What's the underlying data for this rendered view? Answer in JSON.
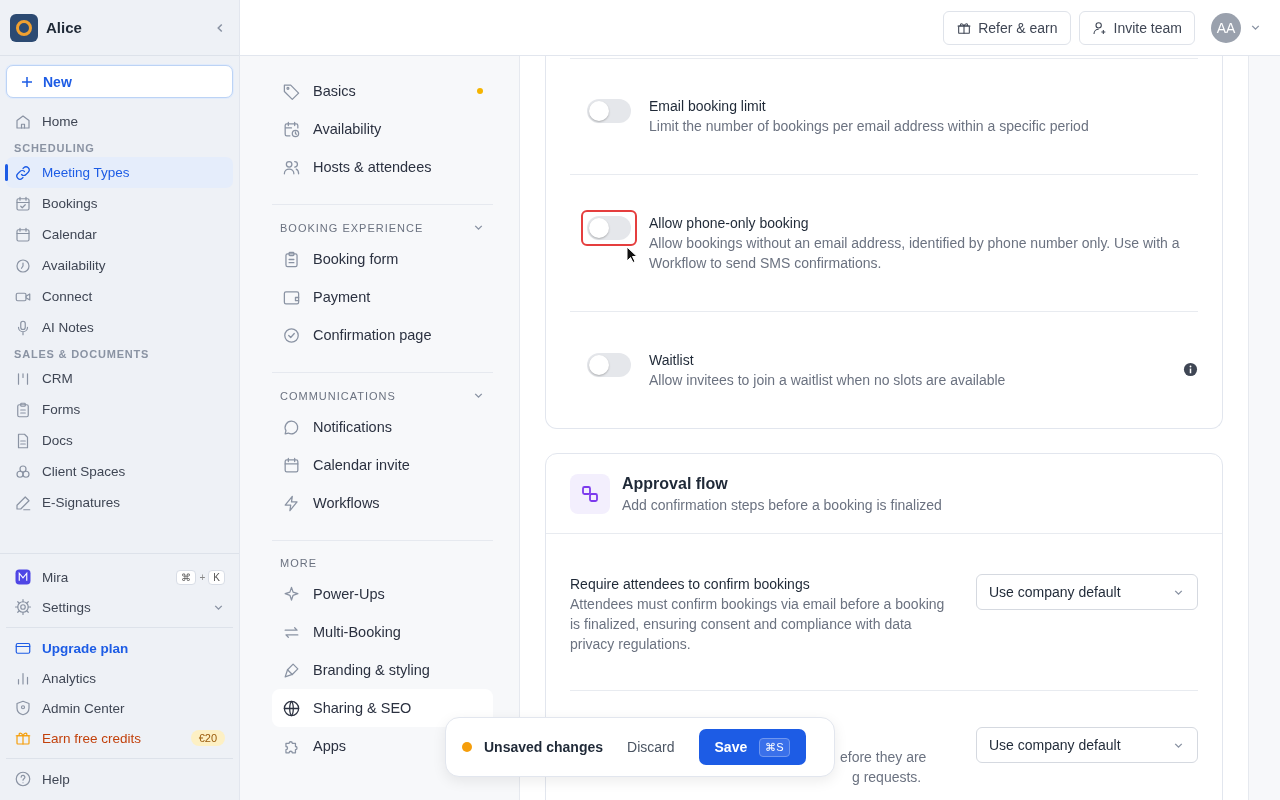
{
  "workspace": {
    "name": "Alice"
  },
  "sidebar": {
    "new_button": "New",
    "items": [
      {
        "label": "Home",
        "selected": false
      }
    ],
    "sections": [
      {
        "heading": "SCHEDULING",
        "items": [
          {
            "label": "Meeting Types",
            "selected": true
          },
          {
            "label": "Bookings",
            "selected": false
          },
          {
            "label": "Calendar",
            "selected": false
          },
          {
            "label": "Availability",
            "selected": false
          },
          {
            "label": "Connect",
            "selected": false
          },
          {
            "label": "AI Notes",
            "selected": false
          }
        ]
      },
      {
        "heading": "SALES & DOCUMENTS",
        "items": [
          {
            "label": "CRM",
            "selected": false
          },
          {
            "label": "Forms",
            "selected": false
          },
          {
            "label": "Docs",
            "selected": false
          },
          {
            "label": "Client Spaces",
            "selected": false
          },
          {
            "label": "E-Signatures",
            "selected": false
          }
        ]
      }
    ],
    "assistant": {
      "label": "Mira",
      "shortcut": [
        "⌘",
        "+",
        "K"
      ]
    },
    "settings": {
      "label": "Settings",
      "expanded": false
    },
    "bottom": [
      {
        "kind": "upgrade",
        "label": "Upgrade plan"
      },
      {
        "kind": "plain",
        "label": "Analytics"
      },
      {
        "kind": "plain",
        "label": "Admin Center"
      },
      {
        "kind": "promo",
        "label": "Earn free credits",
        "badge": "€20"
      }
    ],
    "help": "Help"
  },
  "top_bar": {
    "buttons": [
      "Refer & earn",
      "Invite team"
    ],
    "avatar": "AA"
  },
  "settings_nav": {
    "items": [
      {
        "label": "Basics",
        "selected": false,
        "modified": true
      },
      {
        "label": "Availability",
        "selected": false,
        "modified": false
      },
      {
        "label": "Hosts & attendees",
        "selected": false,
        "modified": false
      }
    ],
    "groups": [
      {
        "heading": "BOOKING EXPERIENCE",
        "expanded": true,
        "items": [
          {
            "label": "Booking form",
            "selected": false
          },
          {
            "label": "Payment",
            "selected": false
          },
          {
            "label": "Confirmation page",
            "selected": false
          }
        ]
      },
      {
        "heading": "COMMUNICATIONS",
        "expanded": true,
        "items": [
          {
            "label": "Notifications",
            "selected": false
          },
          {
            "label": "Calendar invite",
            "selected": false
          },
          {
            "label": "Workflows",
            "selected": false
          }
        ]
      },
      {
        "heading": "MORE",
        "items": [
          {
            "label": "Power-Ups",
            "selected": false
          },
          {
            "label": "Multi-Booking",
            "selected": false
          },
          {
            "label": "Branding & styling",
            "selected": false
          },
          {
            "label": "Sharing & SEO",
            "selected": true
          },
          {
            "label": "Apps",
            "selected": false
          }
        ]
      }
    ]
  },
  "toggles": [
    {
      "title": "Email booking limit",
      "description": "Limit the number of bookings per email address within a specific period",
      "on": false,
      "focused": false
    },
    {
      "title": "Allow phone-only booking",
      "description": "Allow bookings without an email address, identified by phone number only. Use with a Workflow to send SMS confirmations.",
      "on": false,
      "focused": true
    },
    {
      "title": "Waitlist",
      "description": "Allow invitees to join a waitlist when no slots are available",
      "on": false,
      "focused": false,
      "info": true
    }
  ],
  "approval_flow": {
    "title": "Approval flow",
    "subtitle": "Add confirmation steps before a booking is finalized",
    "rows": [
      {
        "title": "Require attendees to confirm bookings",
        "description": "Attendees must confirm bookings via email before a booking is finalized, ensuring consent and compliance with data privacy regulations.",
        "select": "Use company default"
      },
      {
        "description_lines": [
          "efore they are",
          "g requests."
        ],
        "select": "Use company default"
      }
    ]
  },
  "toast": {
    "message": "Unsaved changes",
    "discard": "Discard",
    "save": "Save",
    "shortcut": "⌘S"
  }
}
